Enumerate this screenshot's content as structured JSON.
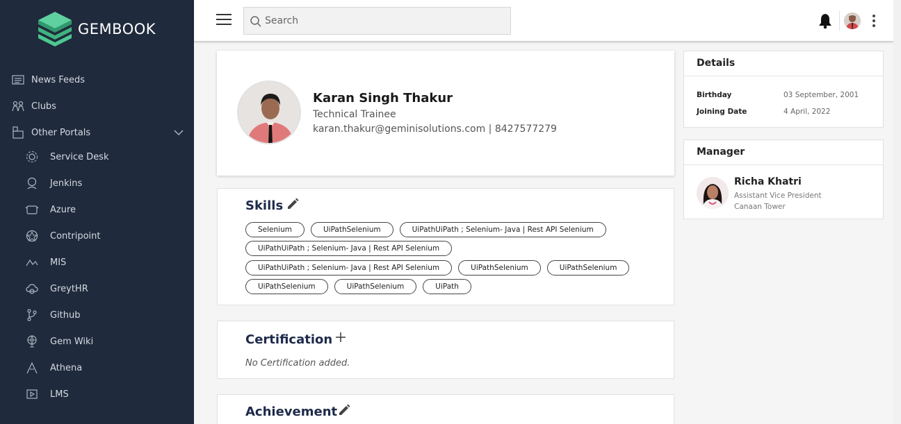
{
  "brand": {
    "name": "GEMBOOK"
  },
  "sidebar": {
    "items": [
      {
        "label": "News Feeds",
        "icon": "news-feed-icon"
      },
      {
        "label": "Clubs",
        "icon": "clubs-icon"
      },
      {
        "label": "Other Portals",
        "icon": "portals-icon"
      }
    ],
    "portals": [
      {
        "label": "Service Desk",
        "icon": "service-desk-icon"
      },
      {
        "label": "Jenkins",
        "icon": "jenkins-icon"
      },
      {
        "label": "Azure",
        "icon": "azure-icon"
      },
      {
        "label": "Contripoint",
        "icon": "contripoint-icon"
      },
      {
        "label": "MIS",
        "icon": "mis-icon"
      },
      {
        "label": "GreytHR",
        "icon": "greythr-icon"
      },
      {
        "label": "Github",
        "icon": "github-icon"
      },
      {
        "label": "Gem Wiki",
        "icon": "gem-wiki-icon"
      },
      {
        "label": "Athena",
        "icon": "athena-icon"
      },
      {
        "label": "LMS",
        "icon": "lms-icon"
      }
    ]
  },
  "topbar": {
    "search_placeholder": "Search"
  },
  "profile": {
    "name": "Karan Singh Thakur",
    "title": "Technical Trainee",
    "contact": "karan.thakur@geminisolutions.com | 8427577279"
  },
  "skills": {
    "title": "Skills",
    "rows": [
      [
        "Selenium",
        "UiPathSelenium",
        "UiPathUiPath ; Selenium- Java | Rest API Selenium"
      ],
      [
        "UiPathUiPath ; Selenium- Java | Rest API Selenium"
      ],
      [
        "UiPathUiPath ; Selenium- Java | Rest API Selenium",
        "UiPathSelenium",
        "UiPathSelenium"
      ],
      [
        "UiPathSelenium",
        "UiPathSelenium",
        "UiPath"
      ]
    ]
  },
  "certification": {
    "title": "Certification",
    "empty_text": "No Certification added."
  },
  "achievement": {
    "title": "Achievement"
  },
  "details": {
    "title": "Details",
    "birthday_label": "Birthday",
    "birthday_value": "03 September, 2001",
    "joining_label": "Joining Date",
    "joining_value": "4 April, 2022"
  },
  "manager": {
    "title": "Manager",
    "name": "Richa Khatri",
    "role": "Assistant Vice President",
    "location": "Canaan Tower"
  },
  "colors": {
    "sidebar_bg": "#1f2a3c",
    "brand_green": "#3fb37f",
    "heading_navy": "#1e2a4a"
  }
}
